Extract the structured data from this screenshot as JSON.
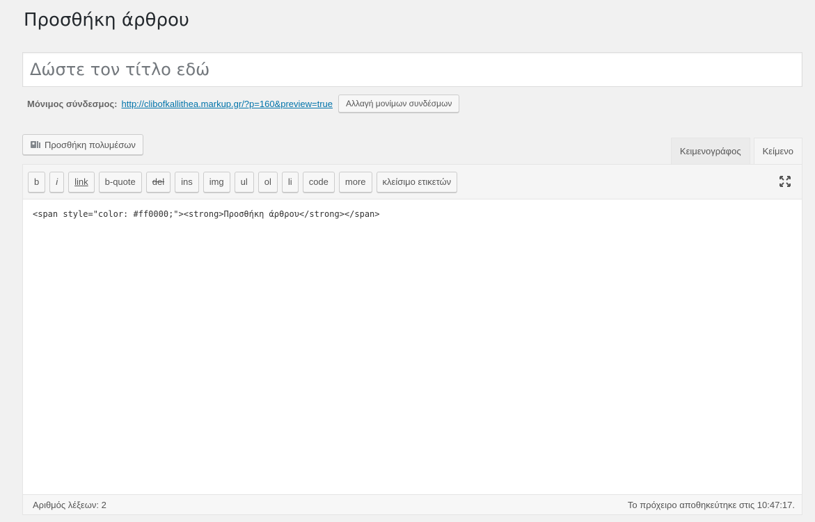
{
  "page": {
    "title": "Προσθήκη άρθρου"
  },
  "title_field": {
    "placeholder": "Δώστε τον τίτλο εδώ"
  },
  "permalink": {
    "label": "Μόνιμος σύνδεσμος:",
    "url": "http://clibofkallithea.markup.gr/?p=160&preview=true",
    "change_button": "Αλλαγή μονίμων συνδέσμων"
  },
  "media": {
    "button_label": "Προσθήκη πολυμέσων",
    "icon": "media-icon"
  },
  "editor_tabs": [
    {
      "label": "Κειμενογράφος",
      "active": false
    },
    {
      "label": "Κείμενο",
      "active": true
    }
  ],
  "quicktags": [
    "b",
    "i",
    "link",
    "b-quote",
    "del",
    "ins",
    "img",
    "ul",
    "ol",
    "li",
    "code",
    "more",
    "κλείσιμο ετικετών"
  ],
  "editor": {
    "content": "<span style=\"color: #ff0000;\"><strong>Προσθήκη άρθρου</strong></span>",
    "fullscreen_icon": "fullscreen-icon"
  },
  "status": {
    "word_count": "Αριθμός λέξεων: 2",
    "draft_saved": "Το πρόχειρο αποθηκεύτηκε στις 10:47:17."
  }
}
